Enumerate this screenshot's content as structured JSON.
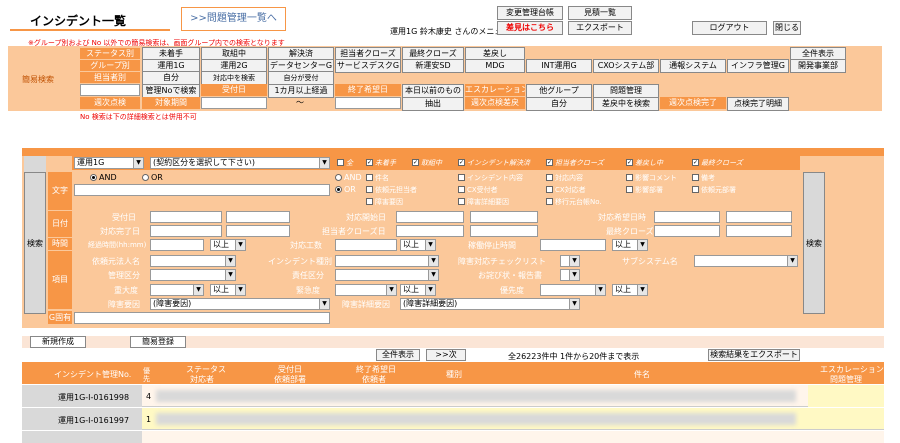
{
  "header": {
    "title": "インシデント一覧",
    "problem_link": ">>問題管理一覧へ",
    "user_menu": "運用1G 鈴木康史 さんのメニュー",
    "btn_change": "変更管理台帳",
    "btn_quote": "見積一覧",
    "btn_submit": "差見はこちら",
    "btn_export": "エクスポート",
    "btn_logout": "ログアウト",
    "btn_close": "閉じる",
    "notice": "※グループ別および No 以外での簡易検索は、画面グループ内での検索となります"
  },
  "quick": {
    "side_label": "簡易検索",
    "status_label": "ステータス別",
    "group_label": "グループ別",
    "owner_label": "担当者別",
    "status_row": [
      "未着手",
      "取組中",
      "解決済",
      "担当者クローズ",
      "最終クローズ",
      "差戻し"
    ],
    "show_all": "全件表示",
    "group_row": [
      "運用1G",
      "運用2G",
      "データセンターG",
      "サービスデスクG",
      "新運安SD",
      "MDG",
      "INT運用G",
      "CXOシステム部",
      "通報システム",
      "インフラ管理G",
      "開発事業部"
    ],
    "owner_row": [
      "自分",
      "対応中を検索",
      "自分が受付"
    ],
    "row4": [
      "管理Noで検索",
      "受付日",
      "1カ月以上経過",
      "終了希望日",
      "本日以前のもの",
      "エスカレーション",
      "他グループ",
      "問題管理"
    ],
    "row5_labels": [
      "週次点検",
      "対象期間"
    ],
    "row5_btns": [
      "抽出",
      "週次点検差戻",
      "自分",
      "差戻中を検索",
      "週次点検完了",
      "点検完了明細"
    ],
    "tilde": "～",
    "no_notice": "No 検索は下の詳細検索とは併用不可"
  },
  "detail": {
    "group_select": "運用1G",
    "contract_select": "(契約区分を選択して下さい)",
    "status_checks": [
      "全",
      "未着手",
      "取組中",
      "インシデント解決済",
      "担当者クローズ",
      "差戻し中",
      "最終クローズ"
    ],
    "text_label": "文字",
    "and_label": "AND",
    "or_label": "OR",
    "text_checks_1": [
      "件名",
      "インシデント内容",
      "対応内容",
      "影響コメント",
      "備考"
    ],
    "text_checks_2": [
      "依頼元担当者",
      "CX受付者",
      "CX対応者",
      "影響部署",
      "依頼元部署"
    ],
    "text_checks_3": [
      "障害要因",
      "障害詳細要因",
      "移行元台帳No."
    ],
    "date_label": "日付",
    "date_fields_1": [
      "受付日",
      "対応開始日",
      "対応希望日時"
    ],
    "date_fields_2": [
      "対応完了日",
      "担当者クローズ日",
      "最終クローズ日"
    ],
    "time_label": "時間",
    "elapsed": "経過時間(hh:mm)",
    "hours": "対応工数",
    "stop_time": "稼働停止時間",
    "cmp": "以上",
    "item_label": "項目",
    "requester": "依頼元法人名",
    "inc_type": "インシデント種別",
    "fault_check": "障害対応チェックリスト",
    "subsystem": "サブシステム名",
    "mgmt_class": "管理区分",
    "resp_class": "責任区分",
    "apology": "お詫び状・報告書",
    "severity": "重大度",
    "urgency": "緊急度",
    "priority": "優先度",
    "fault_cause": "障害要因",
    "fault_cause_val": "(障害要因)",
    "fault_detail": "障害詳細要因",
    "fault_detail_val": "(障害詳細要因)",
    "gid": "G固有",
    "search": "検索"
  },
  "list": {
    "btn_new": "新規作成",
    "btn_easy": "簡易登録",
    "btn_show_all": "全件表示",
    "btn_next": ">>次",
    "count_text": "全26223件中 1件から20件まで表示",
    "btn_export": "検索結果をエクスポート",
    "cols": {
      "no": "インシデント管理No.",
      "grade": "優先",
      "status": "ステータス",
      "handler": "対応者",
      "received": "受付日",
      "dept": "依頼部署",
      "end_date": "終了希望日",
      "requester": "依頼者",
      "type": "種別",
      "subject": "件名",
      "escalation": "エスカレーション",
      "problem": "問題管理"
    },
    "rows": [
      {
        "no": "運用1G-I-0161998",
        "grade": "4"
      },
      {
        "no": "運用1G-I-0161997",
        "grade": "1"
      }
    ]
  }
}
